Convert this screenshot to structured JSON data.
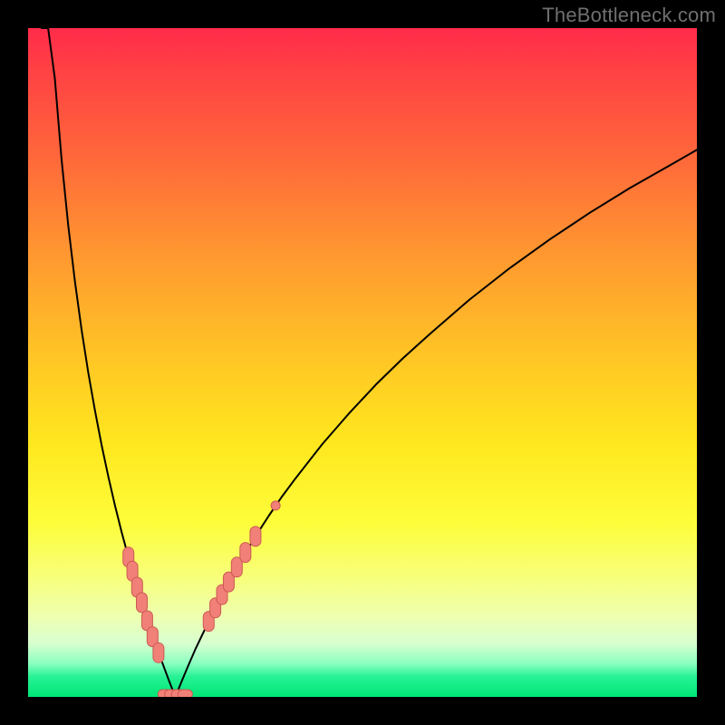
{
  "watermark": "TheBottleneck.com",
  "colors": {
    "frame": "#000000",
    "curve": "#000000",
    "marker_fill": "#f08078",
    "marker_stroke": "#cc5a52"
  },
  "chart_data": {
    "type": "line",
    "title": "",
    "xlabel": "",
    "ylabel": "",
    "xlim": [
      0,
      100
    ],
    "ylim": [
      0,
      100
    ],
    "grid": false,
    "legend": false,
    "curve": {
      "description": "V-shaped bottleneck curve. y ≈ |log(x / x_min)| * k, clamped to [0,100]. Minimum near x ≈ 22, steep left arm, shallower right arm.",
      "x_min_percent": 22,
      "left_slope": 125,
      "right_slope": 55,
      "points_x": [
        2,
        3,
        4,
        5,
        6,
        7,
        8,
        9,
        10,
        11,
        12,
        13,
        14,
        15,
        16,
        17,
        18,
        19,
        20,
        21,
        22,
        23,
        24,
        25,
        26,
        28,
        30,
        32,
        34,
        36,
        38,
        40,
        44,
        48,
        52,
        56,
        60,
        66,
        72,
        78,
        84,
        90,
        96,
        100
      ],
      "points_y": [
        100,
        100,
        92.5,
        80.4,
        70.5,
        62.1,
        54.9,
        48.5,
        42.8,
        37.6,
        32.9,
        28.6,
        24.6,
        20.9,
        17.4,
        14.1,
        11.0,
        8.1,
        5.3,
        2.6,
        0.0,
        2.4,
        4.8,
        7.1,
        9.2,
        13.3,
        17.2,
        20.7,
        24.0,
        27.1,
        30.0,
        32.7,
        37.8,
        42.4,
        46.7,
        50.6,
        54.2,
        59.4,
        64.1,
        68.4,
        72.4,
        76.1,
        79.5,
        81.8
      ]
    },
    "series": [
      {
        "name": "left-arm-markers",
        "type": "scatter",
        "x": [
          15.0,
          15.6,
          16.3,
          17.0,
          17.8,
          18.6,
          19.5
        ],
        "y": [
          20.9,
          18.8,
          16.4,
          14.1,
          11.4,
          9.0,
          6.6
        ]
      },
      {
        "name": "right-arm-markers",
        "type": "scatter",
        "x": [
          27.0,
          28.0,
          29.0,
          30.0,
          31.2,
          32.5,
          34.0
        ],
        "y": [
          11.3,
          13.3,
          15.3,
          17.2,
          19.4,
          21.6,
          24.0
        ]
      },
      {
        "name": "valley-markers",
        "type": "scatter",
        "x": [
          20.5,
          21.5,
          22.5,
          23.5
        ],
        "y": [
          0.0,
          0.0,
          0.0,
          0.0
        ]
      },
      {
        "name": "right-outlier-marker",
        "type": "scatter",
        "x": [
          37.0
        ],
        "y": [
          28.6
        ]
      }
    ]
  }
}
